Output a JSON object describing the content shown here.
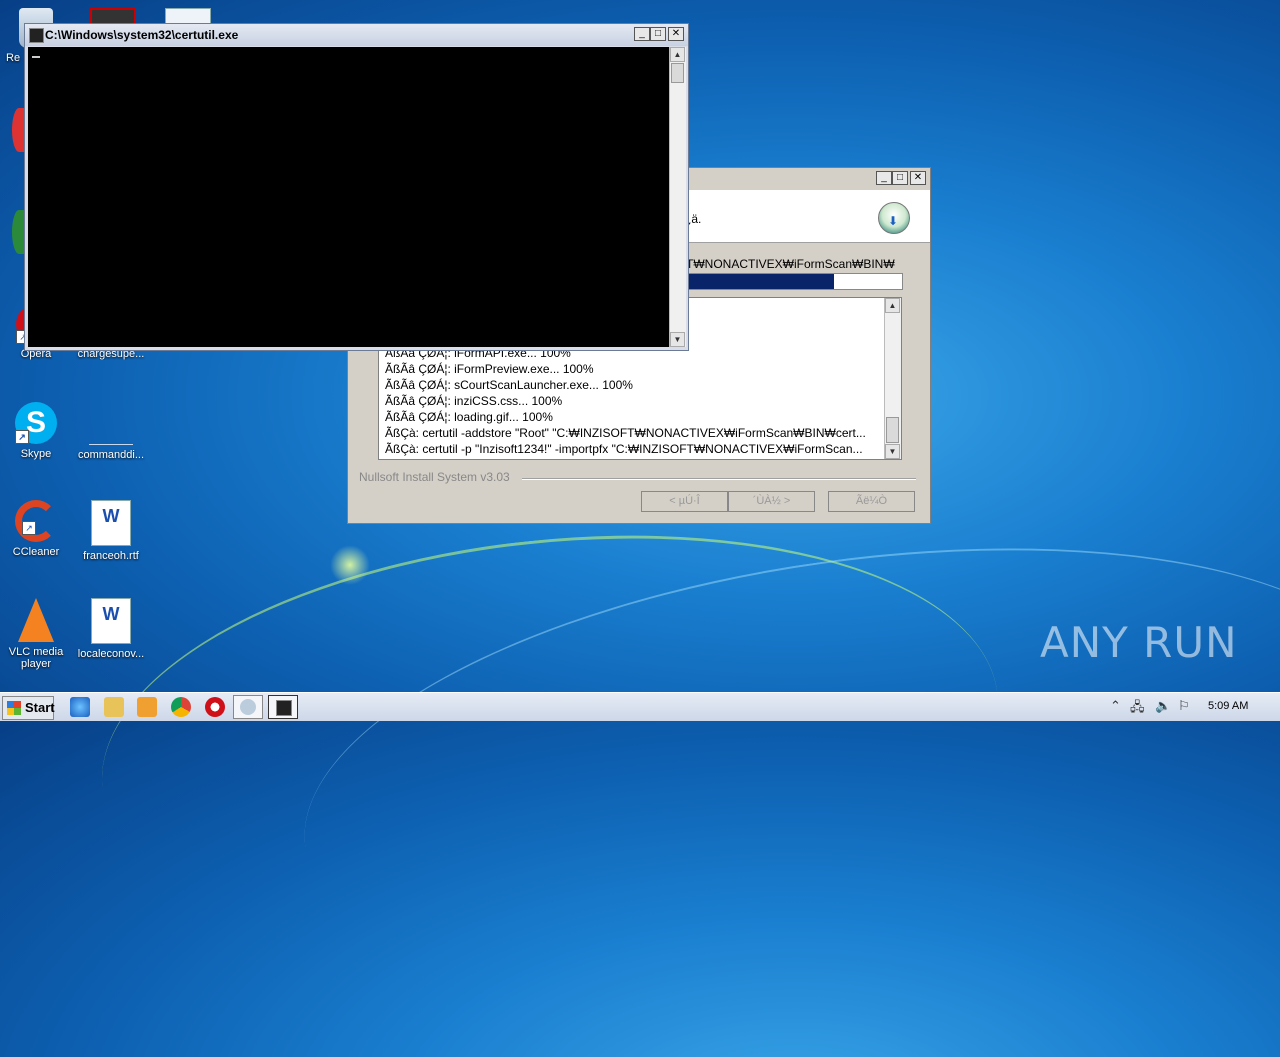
{
  "desktop": {
    "icons": [
      {
        "label": "Re",
        "icon": "recycle-bin-icon"
      },
      {
        "label": "Opera",
        "icon": "opera-icon"
      },
      {
        "label": "chargesupe...",
        "icon": "file-icon"
      },
      {
        "label": "Skype",
        "icon": "skype-icon"
      },
      {
        "label": "commanddi...",
        "icon": "file-icon"
      },
      {
        "label": "CCleaner",
        "icon": "ccleaner-icon"
      },
      {
        "label": "franceoh.rtf",
        "icon": "word-document-icon"
      },
      {
        "label": "VLC media player",
        "icon": "vlc-icon"
      },
      {
        "label": "localeconov...",
        "icon": "word-document-icon"
      }
    ]
  },
  "cmd_window": {
    "title": "C:\\Windows\\system32\\certutil.exe",
    "console_text": ""
  },
  "installer_window": {
    "header_text": "¿ä.",
    "path_text": "T₩NONACTIVEX₩iFormScan₩BIN₩",
    "progress": 0.68,
    "log_lines": [
      "ÃßÃâ ÇØÁ¦: iFormAPI.exe... 100%",
      "ÃßÃâ ÇØÁ¦: iFormPreview.exe... 100%",
      "ÃßÃâ ÇØÁ¦: sCourtScanLauncher.exe... 100%",
      "ÃßÃâ ÇØÁ¦: inziCSS.css... 100%",
      "ÃßÃâ ÇØÁ¦: loading.gif... 100%",
      "ÃßÇà: certutil -addstore \"Root\" \"C:₩INZISOFT₩NONACTIVEX₩iFormScan₩BIN₩cert...",
      "ÃßÇà: certutil -p \"Inzisoft1234!\" -importpfx \"C:₩INZISOFT₩NONACTIVEX₩iFormScan..."
    ],
    "branding": "Nullsoft Install System v3.03",
    "back_button": "< µÚ·Î",
    "next_button": "´ÙÀ½ >",
    "cancel_button": "Ãë¼Ò"
  },
  "taskbar": {
    "start_label": "Start",
    "clock": "5:09 AM"
  },
  "watermark": "ANY RUN"
}
